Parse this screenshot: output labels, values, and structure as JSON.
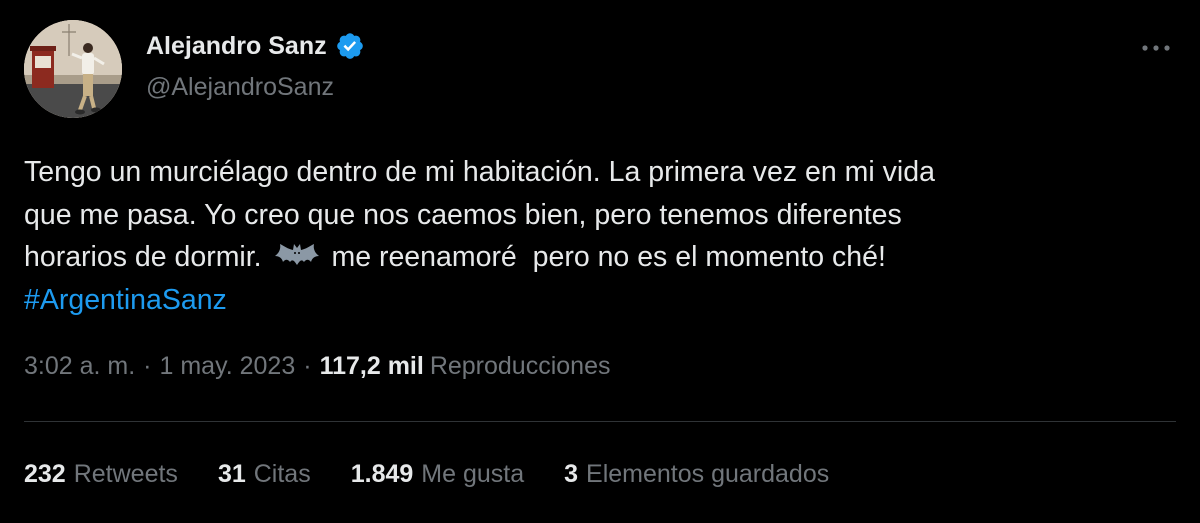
{
  "author": {
    "display_name": "Alejandro Sanz",
    "handle": "@AlejandroSanz",
    "verified_icon": "verified-badge-icon",
    "avatar_icon": "profile-photo"
  },
  "tweet": {
    "text_line1": "Tengo un murciélago dentro de mi habitación. La primera vez en mi vida",
    "text_line2": "que me pasa. Yo creo que nos caemos bien, pero tenemos diferentes",
    "text_line3_before_emoji": "horarios de dormir.",
    "emoji": "bat-emoji",
    "text_line3_after_emoji": "me reenamoré  pero no es el momento ché!",
    "hashtag": "#ArgentinaSanz"
  },
  "meta": {
    "time": "3:02 a. m.",
    "separator": "·",
    "date": "1 may. 2023",
    "views_count": "117,2 mil",
    "views_label": "Reproducciones"
  },
  "stats": {
    "retweets_count": "232",
    "retweets_label": "Retweets",
    "quotes_count": "31",
    "quotes_label": "Citas",
    "likes_count": "1.849",
    "likes_label": "Me gusta",
    "bookmarks_count": "3",
    "bookmarks_label": "Elementos guardados"
  },
  "colors": {
    "background": "#000000",
    "text": "#e7e9ea",
    "secondary": "#71767b",
    "accent": "#1d9bf0",
    "divider": "#2f3336"
  }
}
